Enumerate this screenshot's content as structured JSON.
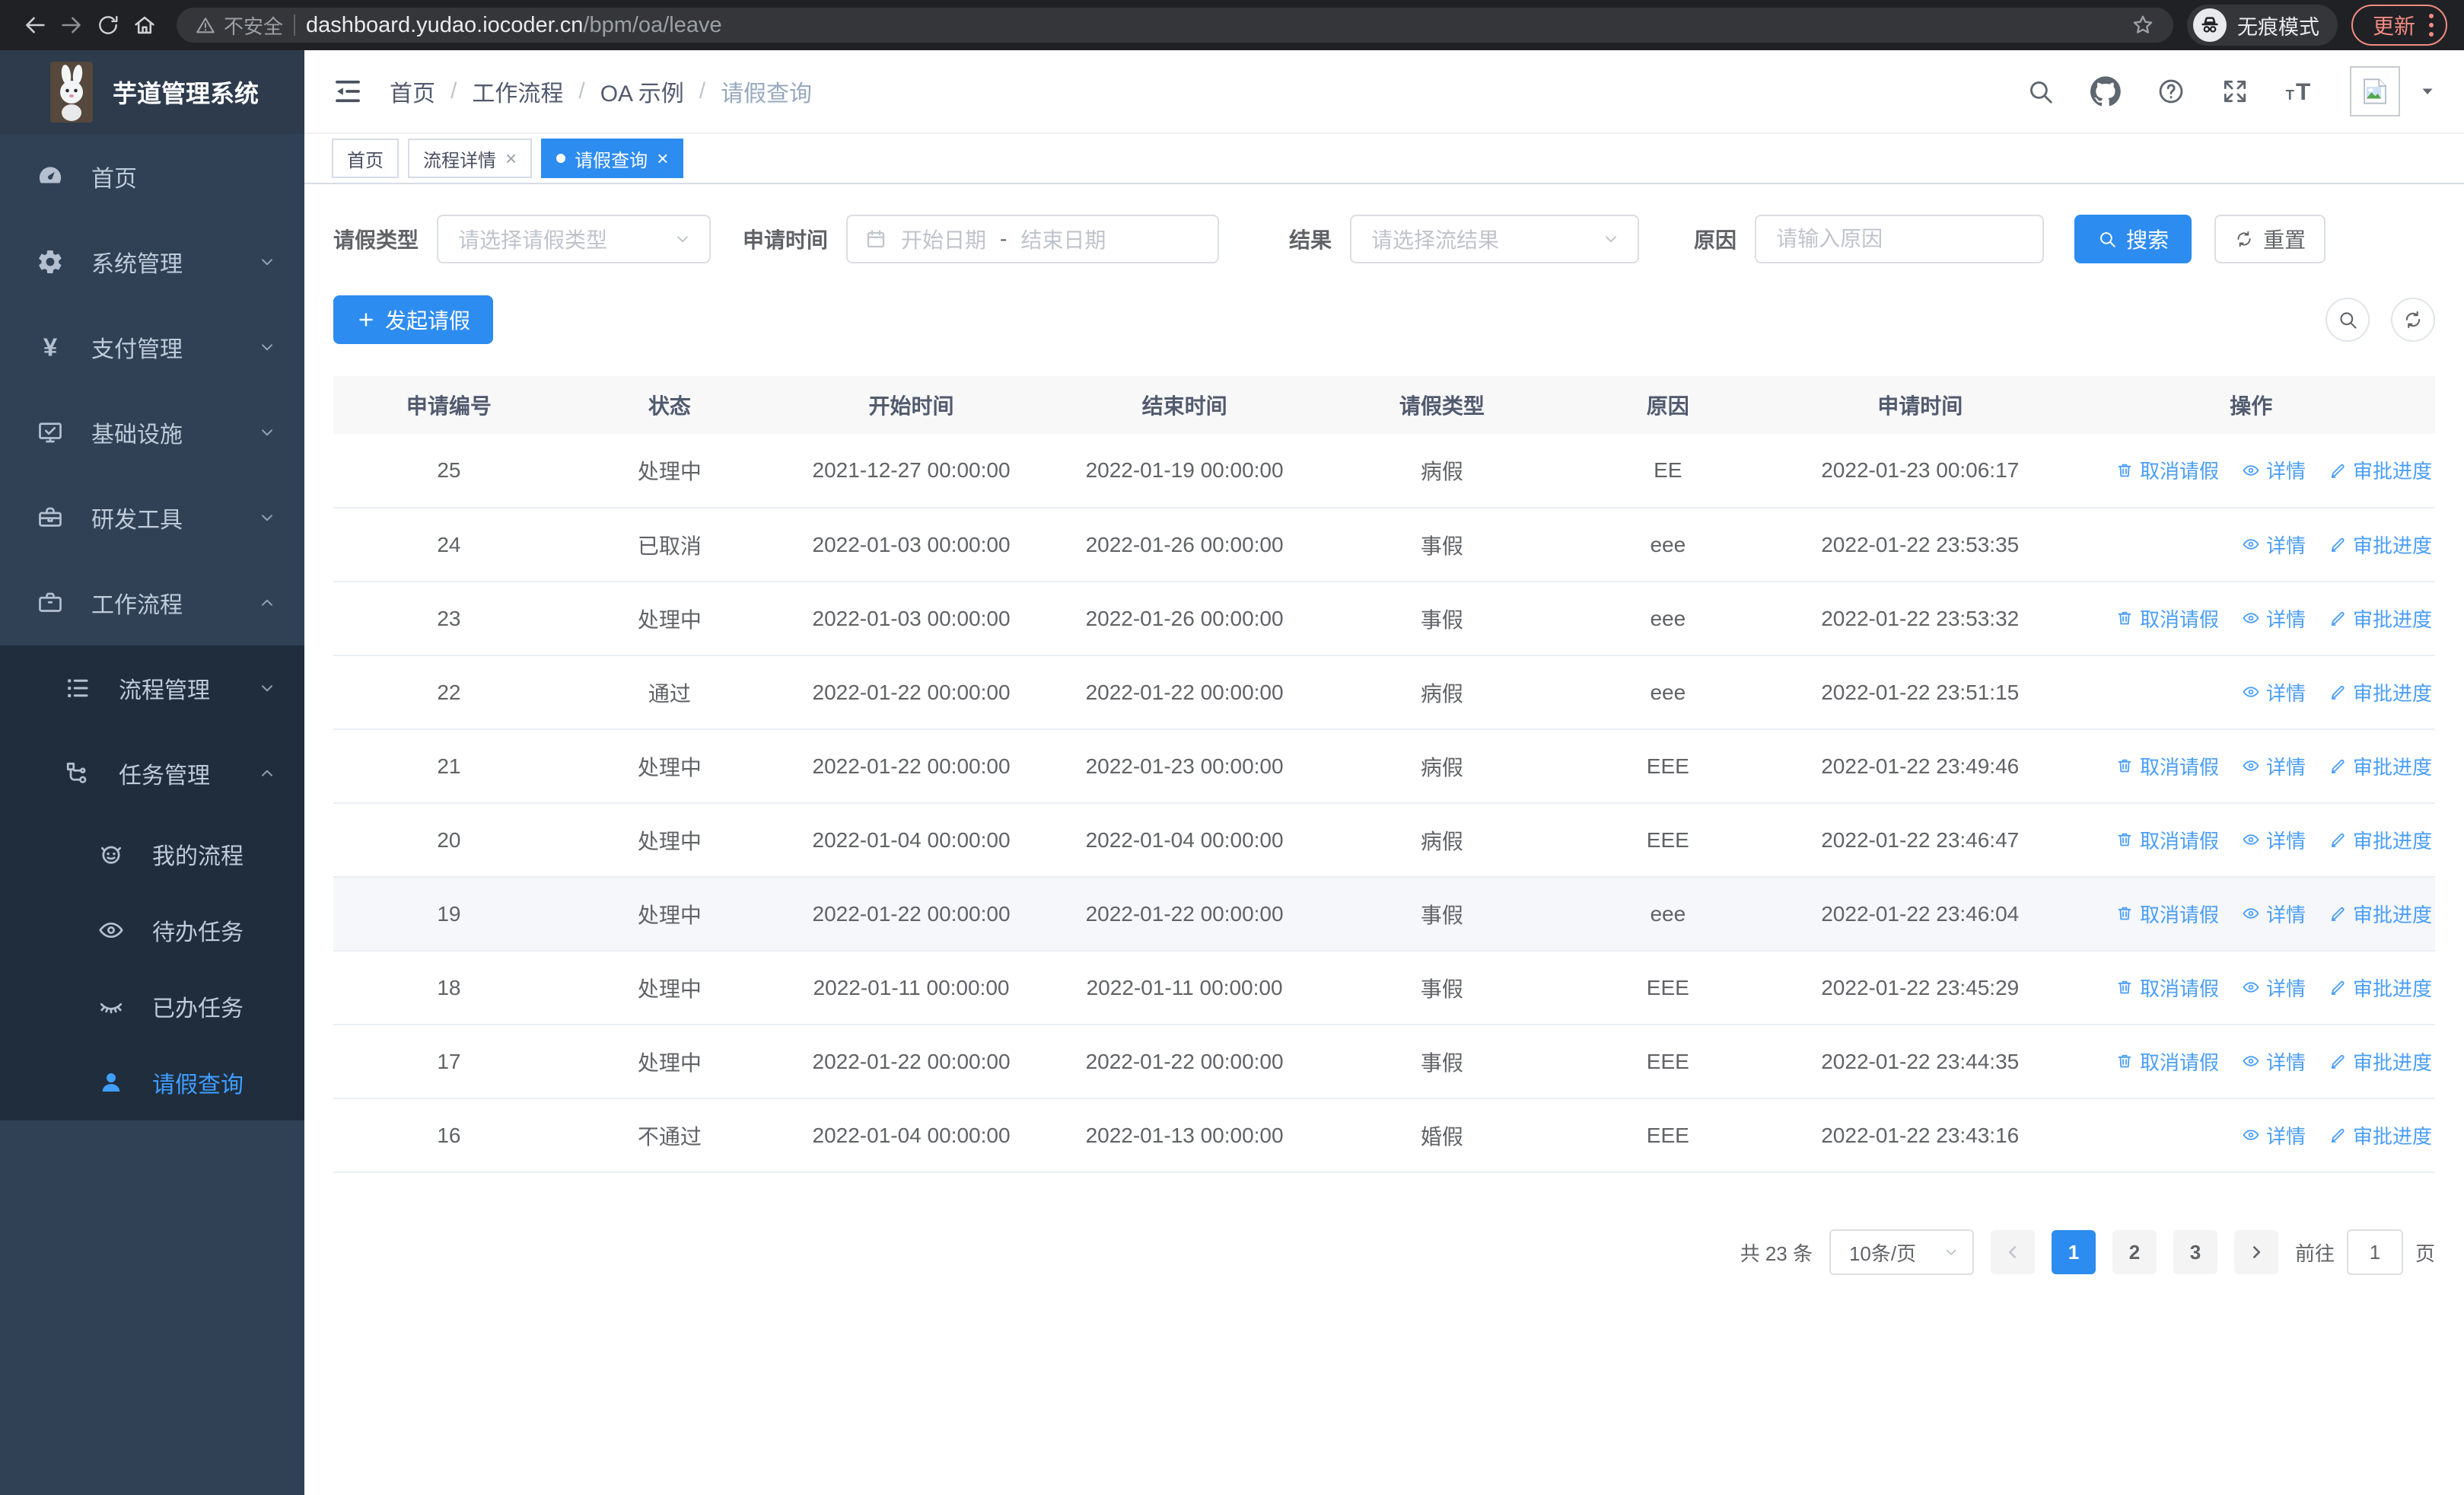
{
  "browser": {
    "security_label": "不安全",
    "url_host": "dashboard.yudao.iocoder.cn",
    "url_path": "/bpm/oa/leave",
    "incognito_label": "无痕模式",
    "update_label": "更新"
  },
  "app_title": "芋道管理系统",
  "header": {
    "breadcrumb": [
      "首页",
      "工作流程",
      "OA 示例",
      "请假查询"
    ]
  },
  "sidebar": {
    "items": [
      {
        "label": "首页",
        "icon": "dashboard"
      },
      {
        "label": "系统管理",
        "icon": "gear",
        "chevron": "down"
      },
      {
        "label": "支付管理",
        "icon": "yen",
        "chevron": "down"
      },
      {
        "label": "基础设施",
        "icon": "monitor",
        "chevron": "down"
      },
      {
        "label": "研发工具",
        "icon": "toolbox",
        "chevron": "down"
      },
      {
        "label": "工作流程",
        "icon": "briefcase",
        "chevron": "up",
        "expanded": true
      }
    ],
    "submenu": [
      {
        "label": "流程管理",
        "icon": "flow-list",
        "chevron": "down"
      },
      {
        "label": "任务管理",
        "icon": "task-tree",
        "chevron": "up",
        "expanded": true,
        "children": [
          {
            "label": "我的流程",
            "icon": "robot"
          },
          {
            "label": "待办任务",
            "icon": "eye"
          },
          {
            "label": "已办任务",
            "icon": "eye-closed"
          },
          {
            "label": "请假查询",
            "icon": "user",
            "active": true
          }
        ]
      }
    ]
  },
  "tabs": [
    {
      "label": "首页",
      "closable": false,
      "active": false
    },
    {
      "label": "流程详情",
      "closable": true,
      "active": false
    },
    {
      "label": "请假查询",
      "closable": true,
      "active": true
    }
  ],
  "filters": {
    "type_label": "请假类型",
    "type_placeholder": "请选择请假类型",
    "time_label": "申请时间",
    "time_start_placeholder": "开始日期",
    "time_separator": "-",
    "time_end_placeholder": "结束日期",
    "result_label": "结果",
    "result_placeholder": "请选择流结果",
    "reason_label": "原因",
    "reason_placeholder": "请输入原因",
    "search_label": "搜索",
    "reset_label": "重置"
  },
  "toolbar": {
    "create_label": "发起请假"
  },
  "table": {
    "columns": [
      "申请编号",
      "状态",
      "开始时间",
      "结束时间",
      "请假类型",
      "原因",
      "申请时间",
      "操作"
    ],
    "action_labels": {
      "cancel": "取消请假",
      "detail": "详情",
      "progress": "审批进度"
    },
    "rows": [
      {
        "id": "25",
        "status": "处理中",
        "start": "2021-12-27 00:00:00",
        "end": "2022-01-19 00:00:00",
        "type": "病假",
        "reason": "EE",
        "apply": "2022-01-23 00:06:17",
        "actions": [
          "cancel",
          "detail",
          "progress"
        ],
        "highlight": false
      },
      {
        "id": "24",
        "status": "已取消",
        "start": "2022-01-03 00:00:00",
        "end": "2022-01-26 00:00:00",
        "type": "事假",
        "reason": "eee",
        "apply": "2022-01-22 23:53:35",
        "actions": [
          "detail",
          "progress"
        ],
        "highlight": false
      },
      {
        "id": "23",
        "status": "处理中",
        "start": "2022-01-03 00:00:00",
        "end": "2022-01-26 00:00:00",
        "type": "事假",
        "reason": "eee",
        "apply": "2022-01-22 23:53:32",
        "actions": [
          "cancel",
          "detail",
          "progress"
        ],
        "highlight": false
      },
      {
        "id": "22",
        "status": "通过",
        "start": "2022-01-22 00:00:00",
        "end": "2022-01-22 00:00:00",
        "type": "病假",
        "reason": "eee",
        "apply": "2022-01-22 23:51:15",
        "actions": [
          "detail",
          "progress"
        ],
        "highlight": false
      },
      {
        "id": "21",
        "status": "处理中",
        "start": "2022-01-22 00:00:00",
        "end": "2022-01-23 00:00:00",
        "type": "病假",
        "reason": "EEE",
        "apply": "2022-01-22 23:49:46",
        "actions": [
          "cancel",
          "detail",
          "progress"
        ],
        "highlight": false
      },
      {
        "id": "20",
        "status": "处理中",
        "start": "2022-01-04 00:00:00",
        "end": "2022-01-04 00:00:00",
        "type": "病假",
        "reason": "EEE",
        "apply": "2022-01-22 23:46:47",
        "actions": [
          "cancel",
          "detail",
          "progress"
        ],
        "highlight": false
      },
      {
        "id": "19",
        "status": "处理中",
        "start": "2022-01-22 00:00:00",
        "end": "2022-01-22 00:00:00",
        "type": "事假",
        "reason": "eee",
        "apply": "2022-01-22 23:46:04",
        "actions": [
          "cancel",
          "detail",
          "progress"
        ],
        "highlight": true
      },
      {
        "id": "18",
        "status": "处理中",
        "start": "2022-01-11 00:00:00",
        "end": "2022-01-11 00:00:00",
        "type": "事假",
        "reason": "EEE",
        "apply": "2022-01-22 23:45:29",
        "actions": [
          "cancel",
          "detail",
          "progress"
        ],
        "highlight": false
      },
      {
        "id": "17",
        "status": "处理中",
        "start": "2022-01-22 00:00:00",
        "end": "2022-01-22 00:00:00",
        "type": "事假",
        "reason": "EEE",
        "apply": "2022-01-22 23:44:35",
        "actions": [
          "cancel",
          "detail",
          "progress"
        ],
        "highlight": false
      },
      {
        "id": "16",
        "status": "不通过",
        "start": "2022-01-04 00:00:00",
        "end": "2022-01-13 00:00:00",
        "type": "婚假",
        "reason": "EEE",
        "apply": "2022-01-22 23:43:16",
        "actions": [
          "detail",
          "progress"
        ],
        "highlight": false
      }
    ]
  },
  "pagination": {
    "total_label": "共 23 条",
    "page_size": "10条/页",
    "pages": [
      "1",
      "2",
      "3"
    ],
    "current": "1",
    "goto_label": "前往",
    "jump_value": "1",
    "page_unit": "页"
  },
  "colors": {
    "primary": "#2d8cf0",
    "link": "#4a9ef8",
    "sidebar_bg": "#304156",
    "submenu_bg": "#1f2d3d",
    "sidebar_text": "#bfcbd9",
    "active_text": "#409eff",
    "update_accent": "#f28b82",
    "header_icon": "#5f6670",
    "table_header_bg": "#f8f8f9",
    "row_highlight": "#f5f7fa"
  }
}
